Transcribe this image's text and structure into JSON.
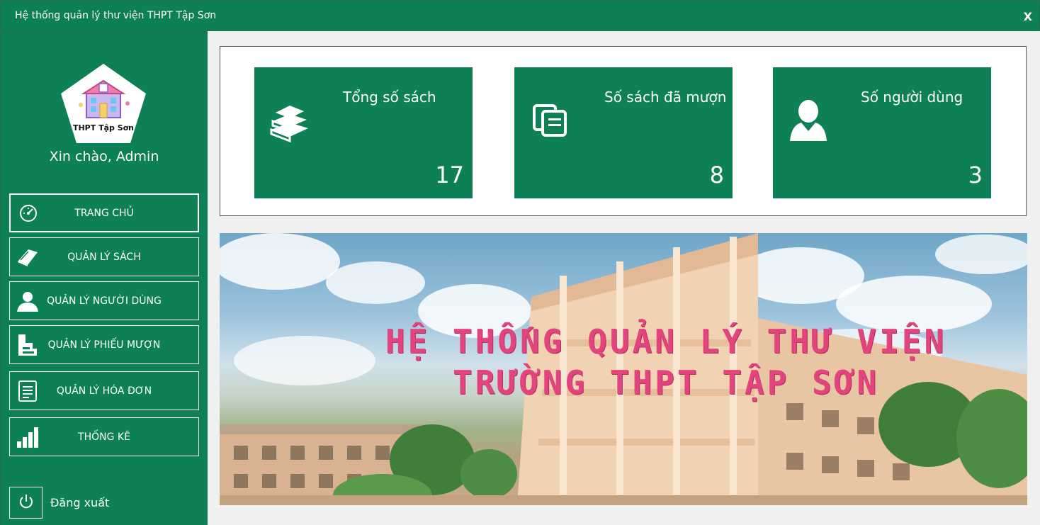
{
  "window": {
    "title": "Hệ thống quản lý thư viện THPT Tập Sơn",
    "close_label": "X"
  },
  "sidebar": {
    "logo_text": "THPT Tập Sơn",
    "greeting": "Xin chào, Admin",
    "items": [
      {
        "label": "TRANG CHỦ",
        "icon": "speedometer-icon",
        "active": true
      },
      {
        "label": "QUẢN LÝ SÁCH",
        "icon": "book-icon"
      },
      {
        "label": "QUẢN LÝ NGƯỜI DÙNG",
        "icon": "user-icon"
      },
      {
        "label": "QUẢN LÝ PHIẾU MƯỢN",
        "icon": "form-icon"
      },
      {
        "label": "QUẢN LÝ HÓA ĐƠN",
        "icon": "receipt-icon"
      },
      {
        "label": "THỐNG KÊ",
        "icon": "bar-chart-icon"
      }
    ],
    "logout_label": "Đăng xuất"
  },
  "stats": [
    {
      "title": "Tổng số sách",
      "value": "17",
      "icon": "books-stack-icon"
    },
    {
      "title": "Số sách đã mượn",
      "value": "8",
      "icon": "copy-books-icon"
    },
    {
      "title": "Số người dùng",
      "value": "3",
      "icon": "user-silhouette-icon"
    }
  ],
  "banner": {
    "line1": "HỆ THỐNG QUẢN LÝ THƯ VIỆN",
    "line2": "TRƯỜNG THPT TẬP SƠN"
  },
  "colors": {
    "primary": "#0e8055",
    "banner_text": "#e2447e",
    "background": "#f0f0f0"
  }
}
